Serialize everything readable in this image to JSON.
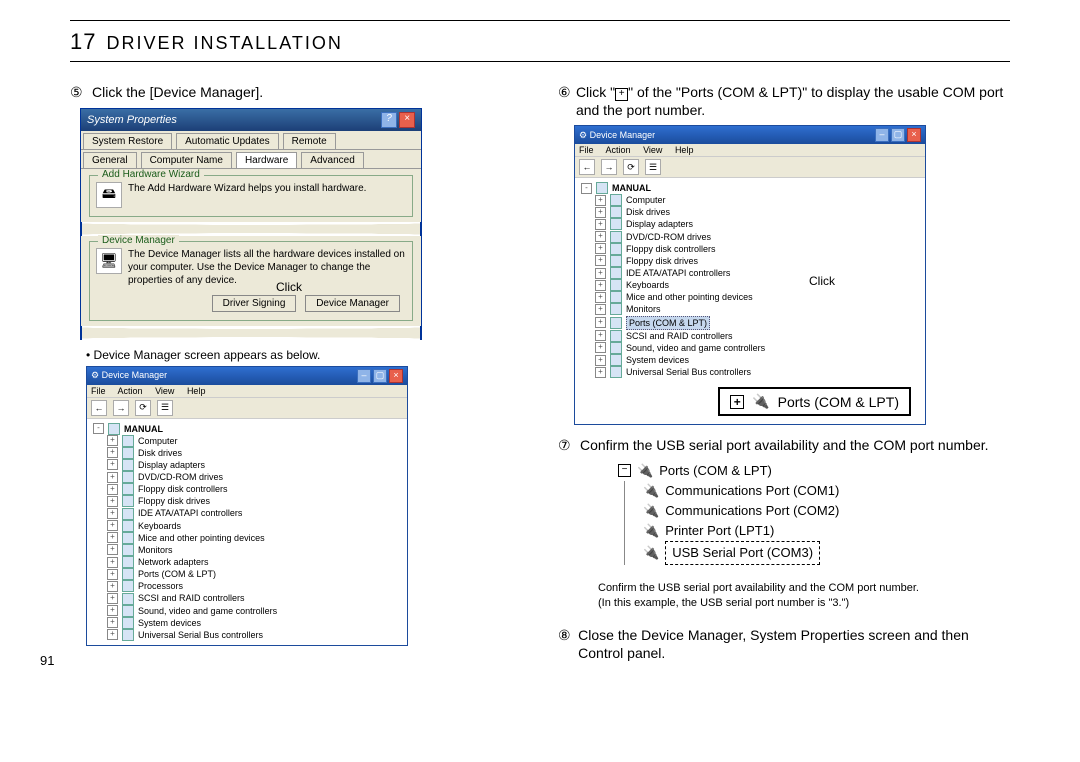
{
  "page_number": "91",
  "chapter_number": "17",
  "chapter_title": "DRIVER INSTALLATION",
  "left": {
    "step5": "Click the [Device Manager].",
    "sysprop": {
      "title": "System Properties",
      "tabs_row1": [
        "System Restore",
        "Automatic Updates",
        "Remote"
      ],
      "tabs_row2": [
        "General",
        "Computer Name",
        "Hardware",
        "Advanced"
      ],
      "hardware_wizard": {
        "title": "Add Hardware Wizard",
        "text": "The Add Hardware Wizard helps you install hardware."
      },
      "device_mgr_group": {
        "title": "Device Manager",
        "text": "The Device Manager lists all the hardware devices installed on your computer. Use the Device Manager to change the properties of any device.",
        "btn_signing": "Driver Signing",
        "btn_devmgr": "Device Manager"
      },
      "click_label": "Click"
    },
    "dm_appears": "Device Manager screen appears as below.",
    "devmgr": {
      "title": "Device Manager",
      "menus": [
        "File",
        "Action",
        "View",
        "Help"
      ],
      "root": "MANUAL",
      "items": [
        "Computer",
        "Disk drives",
        "Display adapters",
        "DVD/CD-ROM drives",
        "Floppy disk controllers",
        "Floppy disk drives",
        "IDE ATA/ATAPI controllers",
        "Keyboards",
        "Mice and other pointing devices",
        "Monitors",
        "Network adapters",
        "Ports (COM & LPT)",
        "Processors",
        "SCSI and RAID controllers",
        "Sound, video and game controllers",
        "System devices",
        "Universal Serial Bus controllers"
      ]
    }
  },
  "right": {
    "step6_a": "Click \"",
    "step6_b": "\" of the \"Ports (COM & LPT)\" to display the usable COM port and the port number.",
    "click_label": "Click",
    "ports_callout": "Ports (COM & LPT)",
    "step7": "Confirm the USB serial port availability and the COM port number.",
    "ports_tree": {
      "root": "Ports (COM & LPT)",
      "children": [
        "Communications Port (COM1)",
        "Communications Port (COM2)",
        "Printer Port (LPT1)",
        "USB Serial Port (COM3)"
      ]
    },
    "confirm_note1": "Confirm the USB serial port availability and the COM port number.",
    "confirm_note2": "(In this example, the USB serial port number is \"3.\")",
    "step8": "Close the Device Manager, System Properties screen and then Control panel.",
    "devmgr2": {
      "title": "Device Manager",
      "menus": [
        "File",
        "Action",
        "View",
        "Help"
      ],
      "root": "MANUAL",
      "items": [
        "Computer",
        "Disk drives",
        "Display adapters",
        "DVD/CD-ROM drives",
        "Floppy disk controllers",
        "Floppy disk drives",
        "IDE ATA/ATAPI controllers",
        "Keyboards",
        "Mice and other pointing devices",
        "Monitors",
        "Ports (COM & LPT)",
        "SCSI and RAID controllers",
        "Sound, video and game controllers",
        "System devices",
        "Universal Serial Bus controllers"
      ]
    }
  }
}
